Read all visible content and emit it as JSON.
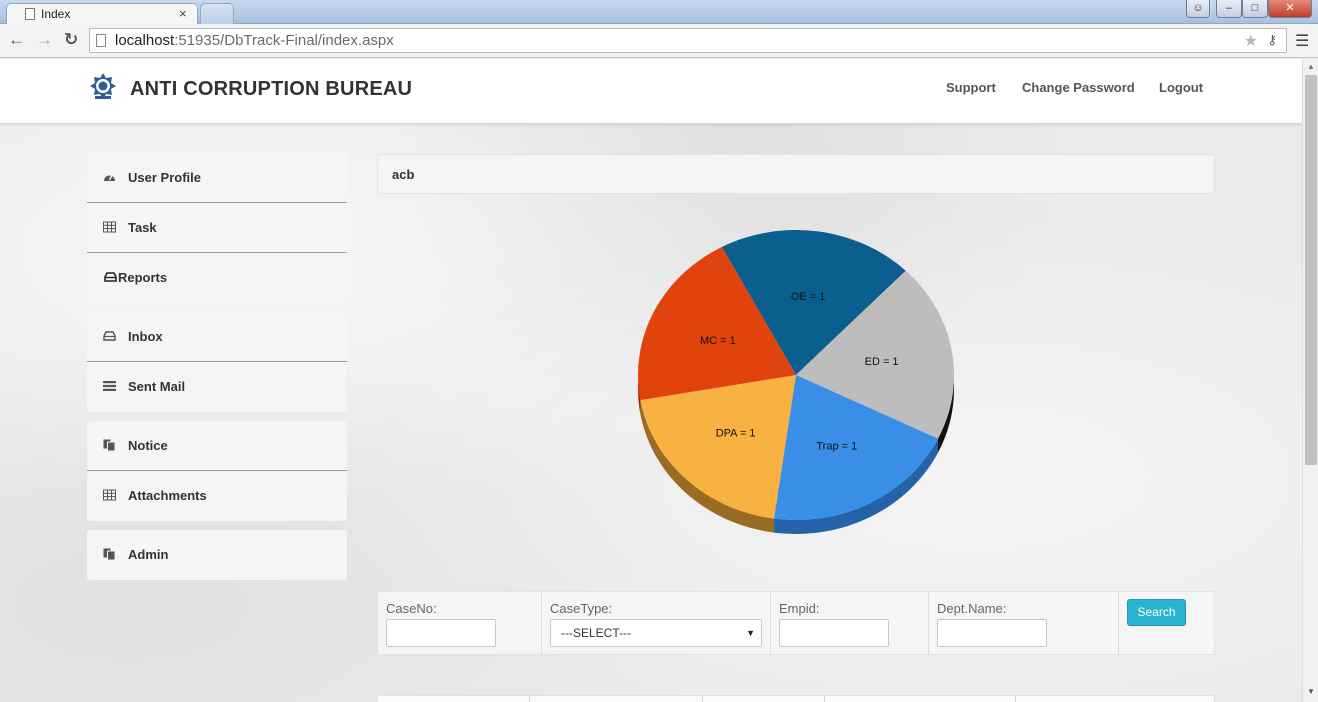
{
  "browser": {
    "tab_title": "Index",
    "tab_close": "×",
    "url_host": "localhost",
    "url_rest": ":51935/DbTrack-Final/index.aspx",
    "window_buttons": {
      "user": "☺",
      "minimize": "‒",
      "maximize": "□",
      "close": "✕"
    }
  },
  "header": {
    "brand": "ANTI CORRUPTION BUREAU",
    "logo_icon": "acb-emblem",
    "nav": {
      "support": "Support",
      "change_password": "Change Password",
      "logout": "Logout"
    }
  },
  "sidebar": {
    "group1": [
      {
        "label": "User Profile",
        "icon": "dashboard-icon"
      },
      {
        "label": "Task",
        "icon": "table-icon"
      },
      {
        "label": "Reports",
        "icon": "inbox-tray-icon"
      }
    ],
    "group2": [
      {
        "label": "Inbox",
        "icon": "inbox-tray-icon"
      },
      {
        "label": "Sent Mail",
        "icon": "list-icon"
      }
    ],
    "group3": [
      {
        "label": "Notice",
        "icon": "copy-icon"
      },
      {
        "label": "Attachments",
        "icon": "table-icon"
      }
    ],
    "group4": [
      {
        "label": "Admin",
        "icon": "copy-icon"
      }
    ]
  },
  "main": {
    "panel_title": "acb",
    "search": {
      "caseno_label": "CaseNo:",
      "caseno_value": "",
      "casetype_label": "CaseType:",
      "casetype_selected": "---SELECT---",
      "empid_label": "Empid:",
      "empid_value": "",
      "dept_label": "Dept.Name:",
      "dept_value": "",
      "search_button": "Search"
    }
  },
  "chart_data": {
    "type": "pie",
    "style": "3d",
    "slices": [
      {
        "label": "OE = 1",
        "value": 1,
        "color": "#0b5f8f",
        "side_color": "#064567"
      },
      {
        "label": "ED = 1",
        "value": 1,
        "color": "#bdbdbd",
        "side_color": "#111111"
      },
      {
        "label": "Trap = 1",
        "value": 1,
        "color": "#3a8ee8",
        "side_color": "#2563a8"
      },
      {
        "label": "DPA = 1",
        "value": 1,
        "color": "#f7b242",
        "side_color": "#9a6b22"
      },
      {
        "label": "MC = 1",
        "value": 1,
        "color": "#e0430c",
        "side_color": "#8d2a07"
      }
    ],
    "start_angle_deg": -118
  }
}
